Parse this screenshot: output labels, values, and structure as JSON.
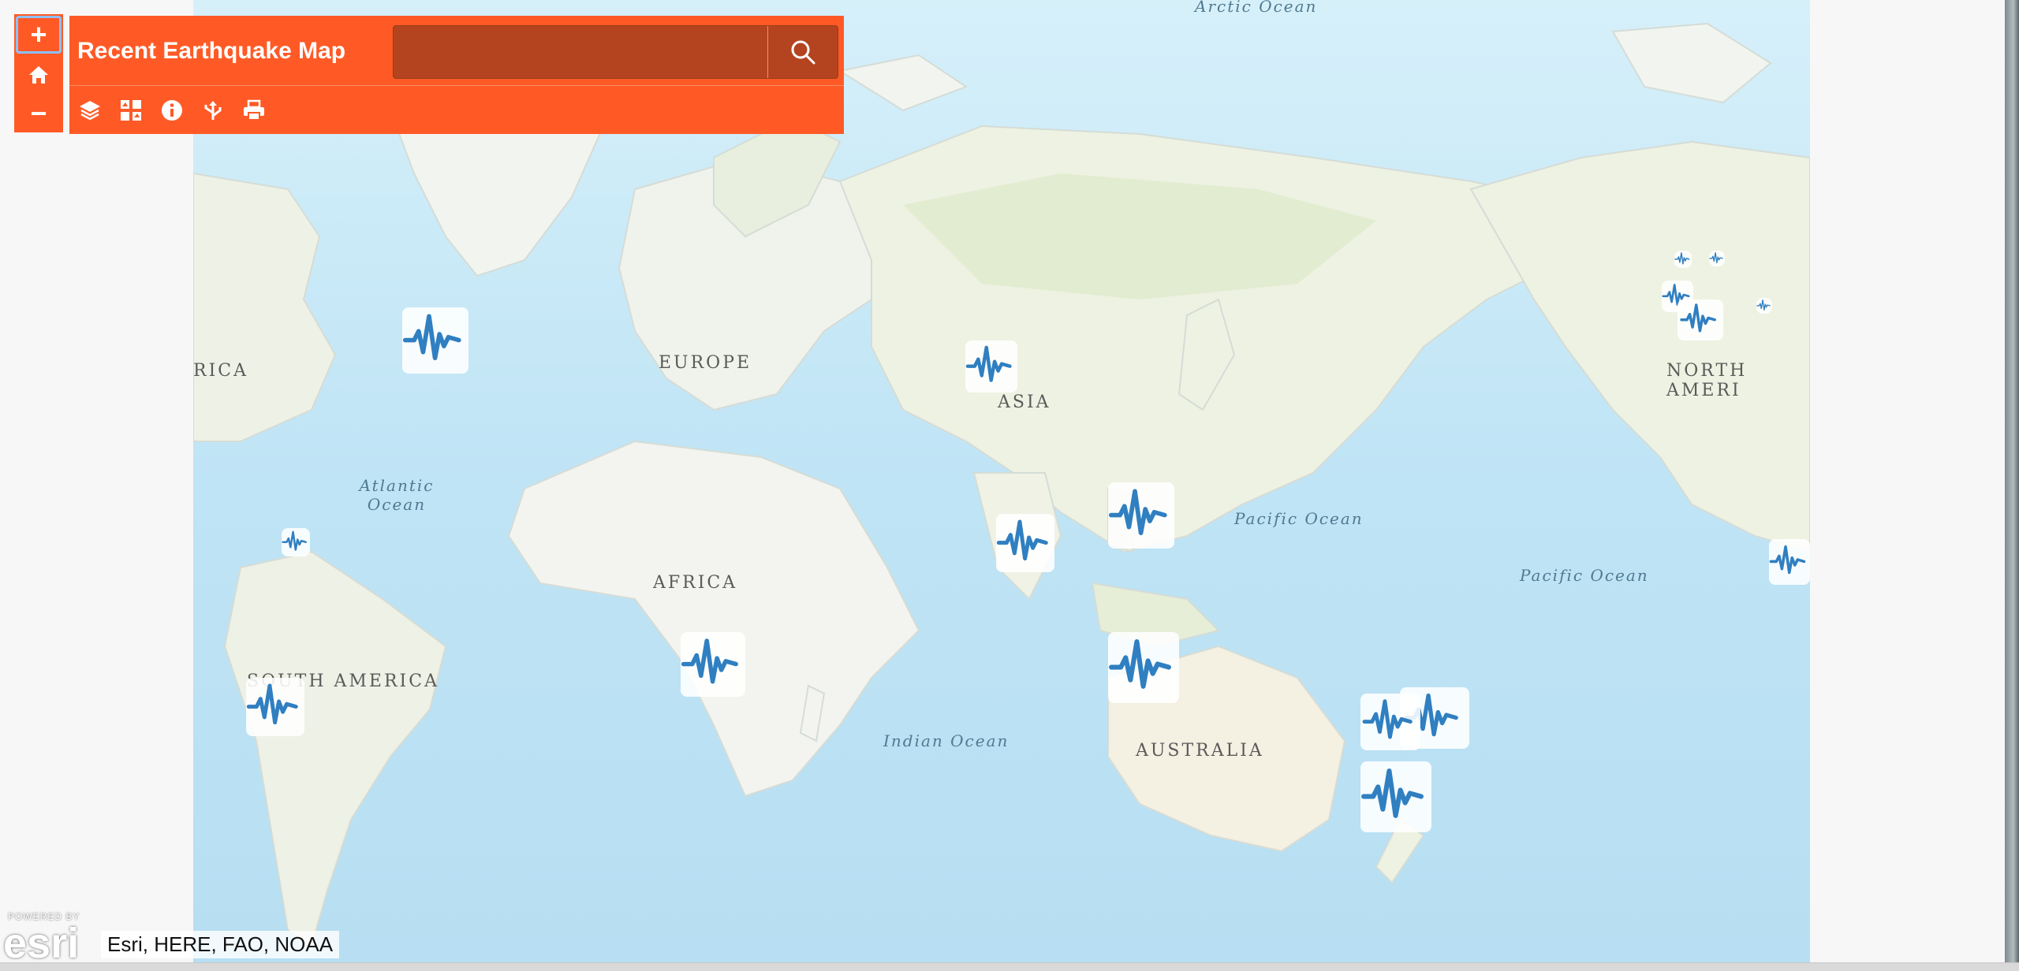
{
  "app": {
    "title": "Recent Earthquake Map"
  },
  "search": {
    "placeholder": "",
    "value": ""
  },
  "zoom": {
    "in_label": "+",
    "out_label": "−"
  },
  "toolbar": {
    "tools": [
      "layers-icon",
      "basemap-gallery-icon",
      "info-icon",
      "share-icon",
      "print-icon"
    ]
  },
  "map": {
    "continent_labels": [
      "EUROPE",
      "ASIA",
      "AFRICA",
      "SOUTH AMERICA",
      "AUSTRALIA",
      "NORTH AMERI",
      "RICA"
    ],
    "ocean_labels": [
      "Arctic Ocean",
      "Atlantic Ocean",
      "Pacific Ocean",
      "Pacific Ocean",
      "Indian Ocean"
    ],
    "marker_icon": "seismograph-icon"
  },
  "attribution": {
    "powered_by": "POWERED BY",
    "logo": "esri",
    "text": "Esri, HERE, FAO, NOAA"
  },
  "colors": {
    "accent": "#ff5a26",
    "search_bg": "#b44420",
    "marker": "#2f7fc1",
    "ocean": "#bfe3f3",
    "land": "#f1f3ec"
  }
}
